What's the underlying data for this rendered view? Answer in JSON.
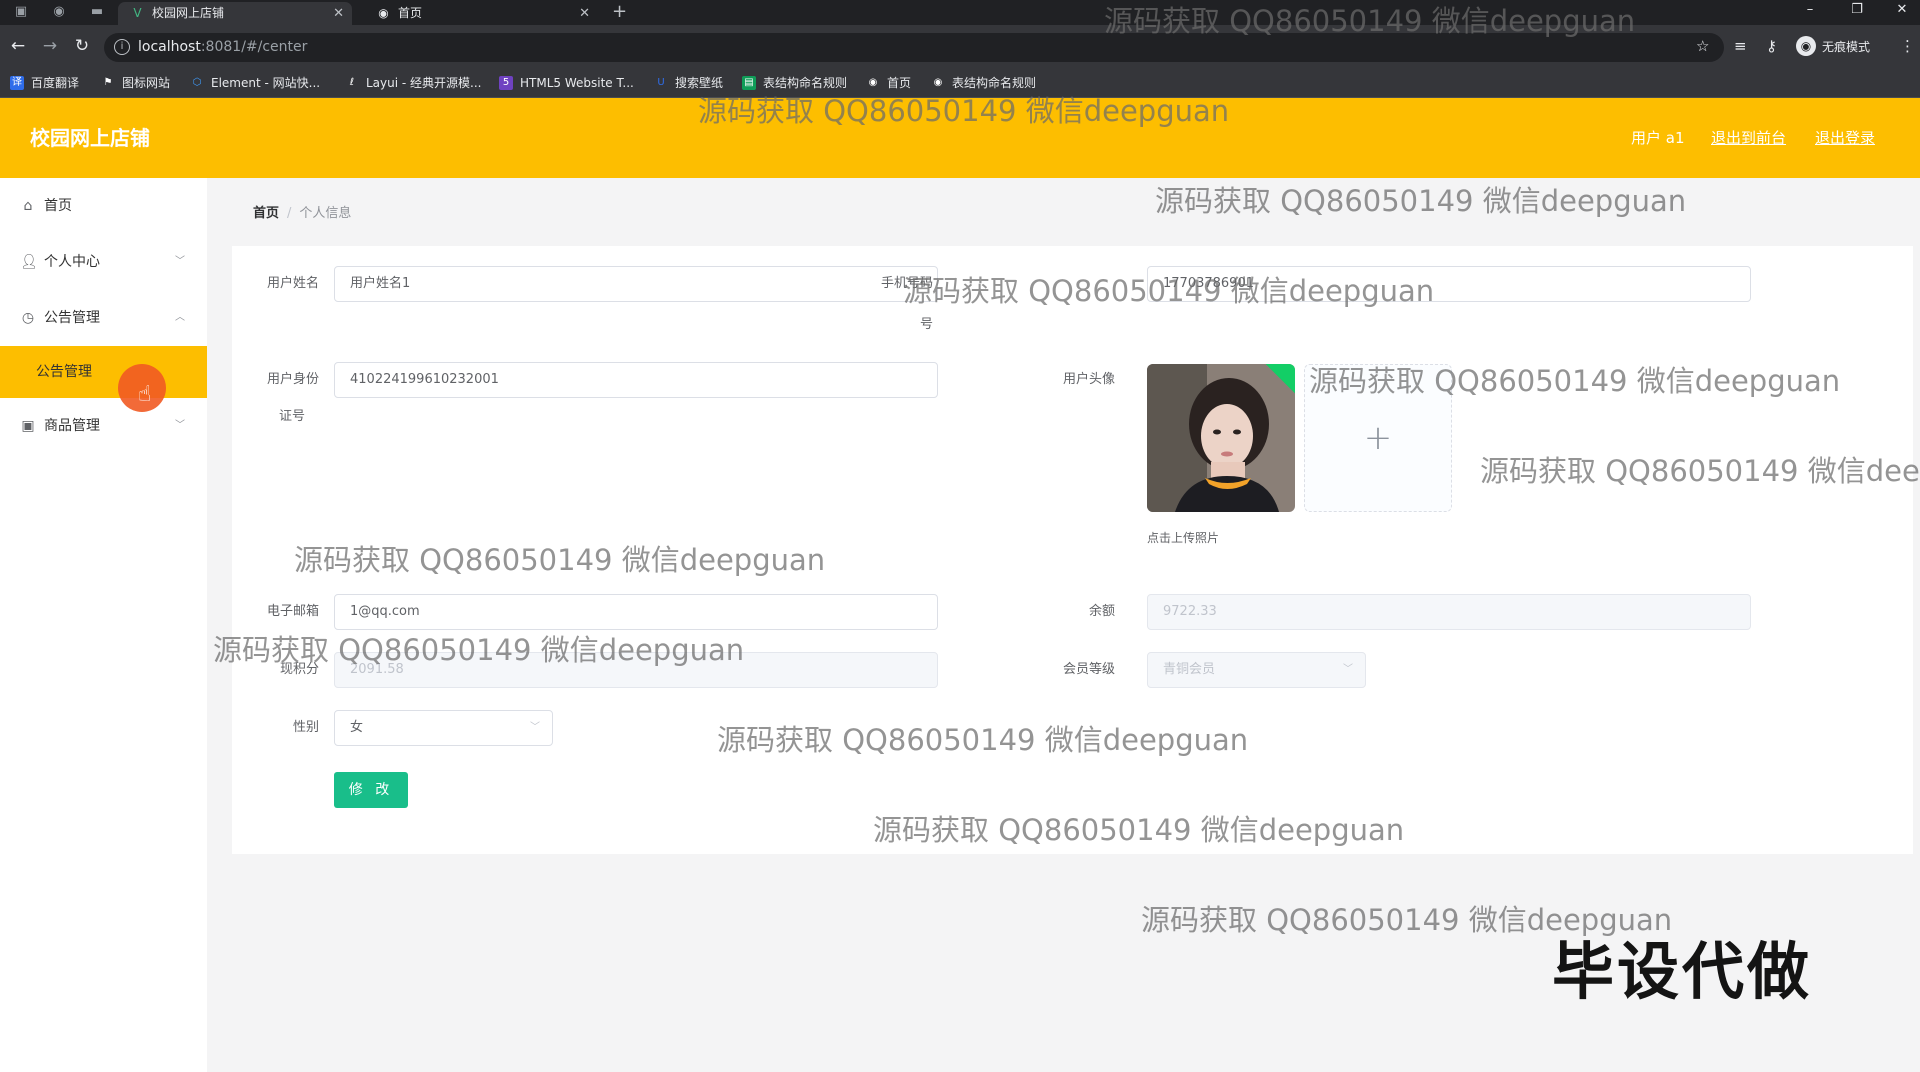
{
  "browser": {
    "tabs": [
      {
        "title": "校园网上店铺",
        "icon": "vue-icon"
      },
      {
        "title": "首页",
        "icon": "globe-icon"
      }
    ],
    "url_host": "localhost",
    "url_rest": ":8081/#/center",
    "incognito_label": "无痕模式",
    "bookmarks": [
      {
        "label": "百度翻译",
        "icon": "baidu-translate-icon",
        "color": "#2f6dea"
      },
      {
        "label": "图标网站",
        "icon": "flag-icon",
        "color": "#35363a"
      },
      {
        "label": "Element - 网站快...",
        "icon": "element-icon",
        "color": "#409eff"
      },
      {
        "label": "Layui - 经典开源模...",
        "icon": "layui-icon",
        "color": "#35363a"
      },
      {
        "label": "HTML5 Website T...",
        "icon": "html5-icon",
        "color": "#6f42c1"
      },
      {
        "label": "搜索壁纸",
        "icon": "wallpaper-icon",
        "color": "#2f6dea"
      },
      {
        "label": "表结构命名规则",
        "icon": "sheet-icon",
        "color": "#0f9d58"
      },
      {
        "label": "首页",
        "icon": "globe-icon",
        "color": "#35363a"
      },
      {
        "label": "表结构命名规则",
        "icon": "globe-icon",
        "color": "#35363a"
      }
    ]
  },
  "header": {
    "title": "校园网上店铺",
    "user": "用户 a1",
    "back_front": "退出到前台",
    "logout": "退出登录",
    "bg_color": "#fdbe00"
  },
  "sidebar": {
    "items": [
      {
        "label": "首页",
        "icon": "home-icon"
      },
      {
        "label": "个人中心",
        "icon": "user-icon"
      },
      {
        "label": "公告管理",
        "icon": "notice-icon"
      },
      {
        "label": "公告管理",
        "sub": true
      },
      {
        "label": "商品管理",
        "icon": "goods-icon"
      }
    ]
  },
  "breadcrumb": {
    "home": "首页",
    "separator": "/",
    "current": "个人信息"
  },
  "form": {
    "username_label": "用户姓名",
    "username": "用户姓名1",
    "phone_label_1": "手机号码",
    "phone_label_2": "号",
    "phone": "17703786901",
    "idcard_label_1": "用户身份",
    "idcard_label_2": "证号",
    "idcard": "410224199610232001",
    "avatar_label": "用户头像",
    "upload_plus": "+",
    "upload_tip": "点击上传照片",
    "email_label": "电子邮箱",
    "email": "1@qq.com",
    "balance_label": "余额",
    "balance": "9722.33",
    "points_label": "现积分",
    "points": "2091.58",
    "level_label": "会员等级",
    "level": "青铜会员",
    "gender_label": "性别",
    "gender": "女",
    "submit": "修 改",
    "submit_color": "#19be8a"
  },
  "watermark": {
    "text": "源码获取 QQ86050149 微信deepguan",
    "text_cut": "源码获取 QQ86050149 微信dee",
    "big": "毕设代做"
  }
}
